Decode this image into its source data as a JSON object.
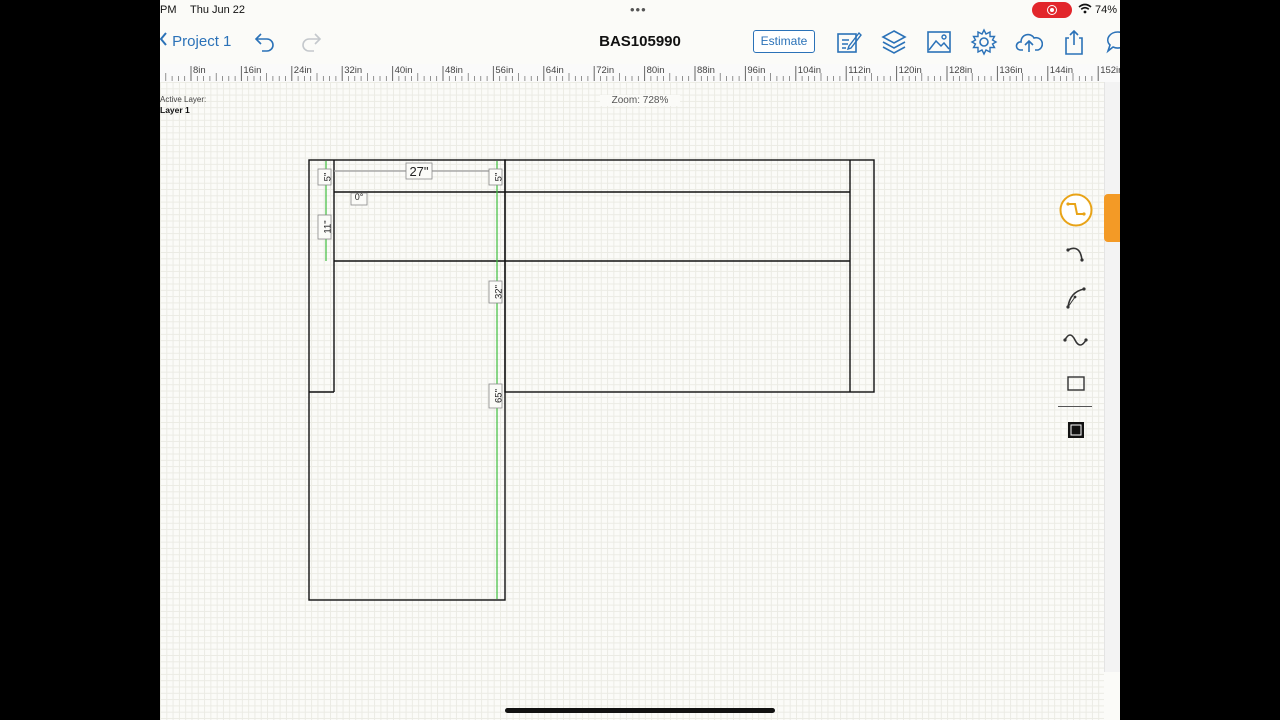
{
  "status_bar": {
    "time": "PM",
    "date": "Thu Jun 22",
    "battery": "74%"
  },
  "nav": {
    "back_label": "Project 1",
    "title": "BAS105990",
    "estimate_label": "Estimate"
  },
  "ruler": {
    "labels": [
      "8in",
      "16in",
      "24in",
      "32in",
      "40in",
      "48in",
      "56in",
      "64in",
      "72in",
      "80in",
      "88in",
      "96in",
      "104in",
      "112in",
      "120in",
      "128in",
      "136in",
      "144in",
      "152in"
    ]
  },
  "layer": {
    "caption": "Active Layer:",
    "name": "Layer 1"
  },
  "zoom": {
    "text": "Zoom: 728%"
  },
  "dimensions": {
    "top_width": "27\"",
    "left_top": "5\"",
    "right_top": "5\"",
    "left_depth": "11\"",
    "angle": "0°",
    "mid_depth": "32\"",
    "total_depth": "65\""
  },
  "tools": [
    "segment-tool-icon",
    "arc-tool-icon",
    "bezier-tool-icon",
    "curve-tool-icon",
    "rectangle-tool-icon",
    "filled-rectangle-tool-icon"
  ],
  "colors": {
    "accent": "#2b72b8",
    "tool_active": "#e8a317",
    "dimension": "#3fbf3f",
    "record": "#e2262b",
    "side_tab": "#f39a26"
  }
}
